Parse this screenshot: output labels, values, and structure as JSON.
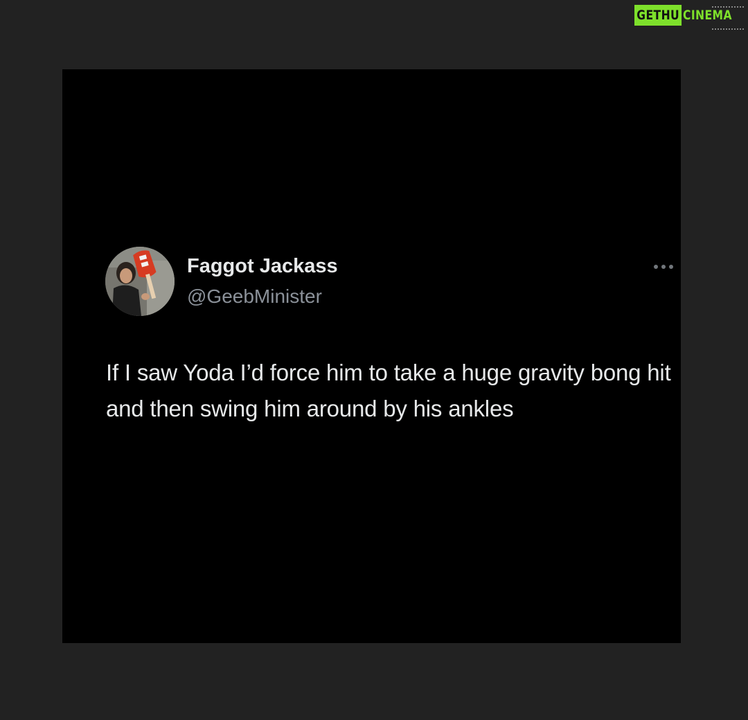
{
  "watermark": {
    "part1": "GETHU",
    "part2": "CINEMA",
    "colors": {
      "accent": "#7ee02b",
      "text_on_accent": "#111111"
    }
  },
  "tweet": {
    "display_name": "Faggot Jackass",
    "handle": "@GeebMinister",
    "text": "If I saw Yoda I’d force him to take a huge gravity bong hit and then swing him around by his ankles",
    "more_icon": "more-horizontal-icon",
    "avatar_icon": "profile-photo"
  },
  "colors": {
    "page_background": "#222222",
    "card_background": "#000000",
    "primary_text": "#e7e9ea",
    "secondary_text": "#8b9199"
  }
}
